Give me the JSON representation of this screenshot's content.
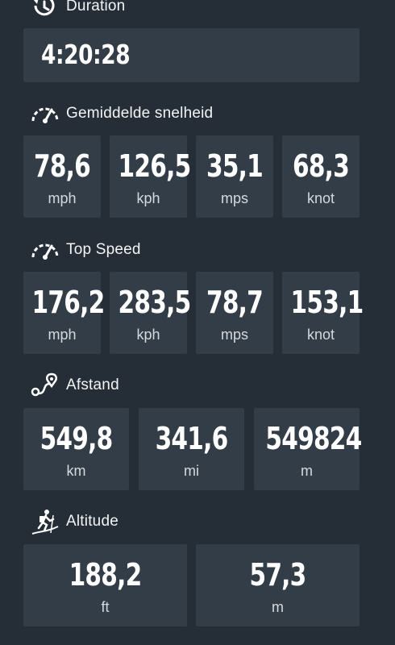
{
  "duration": {
    "title": "Duration",
    "value": "4:20:28",
    "icon": "timer-icon"
  },
  "average_speed": {
    "title": "Gemiddelde snelheid",
    "icon": "speedometer-icon",
    "tiles": [
      {
        "value": "78,6",
        "unit": "mph"
      },
      {
        "value": "126,5",
        "unit": "kph"
      },
      {
        "value": "35,1",
        "unit": "mps"
      },
      {
        "value": "68,3",
        "unit": "knot"
      }
    ]
  },
  "top_speed": {
    "title": "Top Speed",
    "icon": "speedometer-icon",
    "tiles": [
      {
        "value": "176,2",
        "unit": "mph"
      },
      {
        "value": "283,5",
        "unit": "kph"
      },
      {
        "value": "78,7",
        "unit": "mps"
      },
      {
        "value": "153,1",
        "unit": "knot"
      }
    ]
  },
  "distance": {
    "title": "Afstand",
    "icon": "route-icon",
    "tiles": [
      {
        "value": "549,8",
        "unit": "km"
      },
      {
        "value": "341,6",
        "unit": "mi"
      },
      {
        "value": "549824",
        "unit": "m"
      }
    ]
  },
  "altitude": {
    "title": "Altitude",
    "icon": "hiker-icon",
    "tiles": [
      {
        "value": "188,2",
        "unit": "ft"
      },
      {
        "value": "57,3",
        "unit": "m"
      }
    ]
  },
  "colors": {
    "background": "#252d36",
    "tile": "#333d47",
    "text": "#ffffff",
    "unit_text": "#d4d9de"
  }
}
